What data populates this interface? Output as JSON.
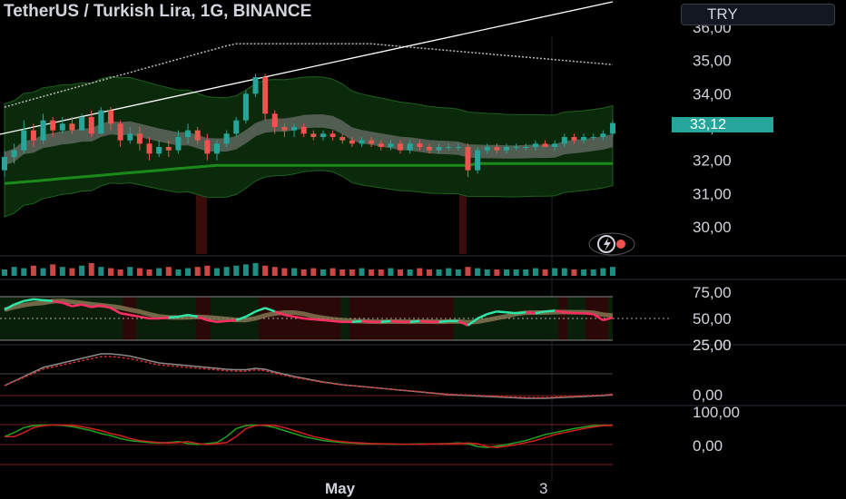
{
  "header": {
    "title": "TetherUS / Turkish Lira, 1G, BINANCE",
    "currency_button": "TRY"
  },
  "price_tag": {
    "value": "33,12",
    "color": "#26a69a"
  },
  "colors": {
    "up": "#26a69a",
    "down": "#ef5350",
    "band_fill": "#0b2a0b",
    "ema_green": "#1b8a1b",
    "rsi_line_up": "#2ee6a8",
    "rsi_line_down": "#ff2e63",
    "white_line": "#ffffff"
  },
  "icons": {
    "logo": "lightning-bolt-icon"
  },
  "chart_data": [
    {
      "type": "candlestick",
      "title": "TetherUS / Turkish Lira, 1G, BINANCE",
      "y_ticks": [
        "30,00",
        "31,00",
        "32,00",
        "33,00",
        "34,00",
        "35,00",
        "36,00"
      ],
      "ylim": [
        29.3,
        36.3
      ],
      "x_ticks": [
        "May",
        "3"
      ],
      "last_price": 33.12,
      "candles": [
        [
          31.7,
          32.3,
          31.5,
          32.1
        ],
        [
          32.1,
          32.5,
          31.9,
          32.3
        ],
        [
          32.3,
          33.2,
          32.2,
          32.9
        ],
        [
          32.9,
          33.1,
          32.4,
          32.6
        ],
        [
          32.6,
          33.4,
          32.5,
          33.2
        ],
        [
          33.2,
          33.3,
          32.7,
          32.9
        ],
        [
          32.9,
          33.3,
          32.8,
          33.1
        ],
        [
          33.1,
          33.3,
          32.8,
          32.9
        ],
        [
          32.9,
          33.4,
          32.9,
          33.3
        ],
        [
          33.3,
          33.5,
          32.7,
          32.8
        ],
        [
          32.8,
          33.6,
          32.8,
          33.5
        ],
        [
          33.5,
          33.6,
          32.9,
          33.1
        ],
        [
          33.1,
          33.2,
          32.4,
          32.6
        ],
        [
          32.6,
          33.0,
          32.5,
          32.8
        ],
        [
          32.8,
          33.0,
          32.3,
          32.5
        ],
        [
          32.5,
          32.7,
          32.0,
          32.2
        ],
        [
          32.2,
          32.6,
          32.1,
          32.4
        ],
        [
          32.4,
          32.6,
          32.1,
          32.3
        ],
        [
          32.3,
          32.9,
          32.2,
          32.7
        ],
        [
          32.7,
          33.1,
          32.5,
          32.9
        ],
        [
          32.9,
          33.0,
          32.5,
          32.6
        ],
        [
          32.6,
          32.8,
          32.0,
          32.2
        ],
        [
          32.2,
          32.6,
          32.0,
          32.5
        ],
        [
          32.5,
          32.9,
          32.4,
          32.8
        ],
        [
          32.8,
          33.3,
          32.7,
          33.2
        ],
        [
          33.2,
          34.1,
          33.1,
          34.0
        ],
        [
          34.0,
          34.6,
          33.9,
          34.5
        ],
        [
          34.5,
          34.6,
          33.2,
          33.4
        ],
        [
          33.4,
          33.5,
          32.8,
          33.0
        ],
        [
          33.0,
          33.1,
          32.7,
          32.9
        ],
        [
          32.9,
          33.1,
          32.7,
          33.0
        ],
        [
          33.0,
          33.1,
          32.7,
          32.8
        ],
        [
          32.8,
          32.9,
          32.6,
          32.7
        ],
        [
          32.7,
          32.9,
          32.6,
          32.8
        ],
        [
          32.8,
          32.9,
          32.6,
          32.7
        ],
        [
          32.7,
          32.8,
          32.5,
          32.6
        ],
        [
          32.6,
          32.7,
          32.4,
          32.5
        ],
        [
          32.5,
          32.7,
          32.4,
          32.6
        ],
        [
          32.6,
          32.7,
          32.4,
          32.5
        ],
        [
          32.5,
          32.6,
          32.3,
          32.4
        ],
        [
          32.4,
          32.6,
          32.3,
          32.5
        ],
        [
          32.5,
          32.6,
          32.2,
          32.3
        ],
        [
          32.3,
          32.6,
          32.2,
          32.5
        ],
        [
          32.5,
          32.6,
          32.3,
          32.4
        ],
        [
          32.4,
          32.5,
          32.2,
          32.3
        ],
        [
          32.3,
          32.5,
          32.2,
          32.4
        ],
        [
          32.4,
          32.5,
          32.3,
          32.4
        ],
        [
          32.4,
          32.5,
          32.3,
          32.4
        ],
        [
          32.4,
          32.5,
          31.5,
          31.7
        ],
        [
          31.7,
          32.4,
          31.6,
          32.3
        ],
        [
          32.3,
          32.5,
          32.2,
          32.4
        ],
        [
          32.4,
          32.5,
          32.2,
          32.3
        ],
        [
          32.3,
          32.5,
          32.2,
          32.4
        ],
        [
          32.4,
          32.5,
          32.3,
          32.4
        ],
        [
          32.4,
          32.5,
          32.3,
          32.4
        ],
        [
          32.4,
          32.6,
          32.3,
          32.5
        ],
        [
          32.5,
          32.6,
          32.4,
          32.4
        ],
        [
          32.4,
          32.6,
          32.3,
          32.5
        ],
        [
          32.5,
          32.8,
          32.4,
          32.7
        ],
        [
          32.7,
          32.8,
          32.5,
          32.6
        ],
        [
          32.6,
          32.8,
          32.5,
          32.7
        ],
        [
          32.7,
          32.8,
          32.6,
          32.7
        ],
        [
          32.7,
          32.9,
          32.6,
          32.8
        ],
        [
          32.8,
          33.2,
          32.7,
          33.12
        ]
      ]
    },
    {
      "type": "bar",
      "name": "volume",
      "values": [
        5,
        7,
        6,
        8,
        6,
        9,
        7,
        6,
        8,
        10,
        7,
        6,
        5,
        7,
        6,
        5,
        6,
        7,
        5,
        6,
        7,
        8,
        6,
        7,
        8,
        9,
        10,
        8,
        7,
        6,
        6,
        5,
        6,
        5,
        6,
        5,
        5,
        6,
        5,
        5,
        6,
        5,
        5,
        6,
        5,
        5,
        6,
        5,
        7,
        6,
        5,
        5,
        5,
        5,
        5,
        6,
        5,
        6,
        6,
        5,
        5,
        5,
        6,
        7
      ]
    },
    {
      "type": "line",
      "name": "oscillator",
      "y_ticks": [
        "25,00",
        "50,00",
        "75,00"
      ],
      "ylim": [
        20,
        80
      ],
      "values": [
        60,
        66,
        70,
        72,
        71,
        70,
        68,
        64,
        66,
        63,
        65,
        62,
        56,
        54,
        52,
        50,
        50,
        51,
        52,
        54,
        52,
        48,
        46,
        47,
        48,
        52,
        58,
        62,
        58,
        54,
        52,
        50,
        49,
        48,
        47,
        46,
        46,
        47,
        46,
        46,
        47,
        46,
        46,
        47,
        46,
        46,
        47,
        47,
        42,
        50,
        55,
        58,
        57,
        56,
        57,
        56,
        58,
        59,
        57,
        56,
        56,
        55,
        48,
        51
      ]
    },
    {
      "type": "line",
      "name": "macd",
      "y_ticks": [
        "0,00",
        "25,00"
      ],
      "values": [
        0.3,
        0.4,
        0.5,
        0.6,
        0.7,
        0.75,
        0.8,
        0.85,
        0.9,
        0.95,
        1.0,
        1.0,
        0.98,
        0.95,
        0.9,
        0.85,
        0.8,
        0.78,
        0.76,
        0.74,
        0.72,
        0.7,
        0.68,
        0.66,
        0.65,
        0.65,
        0.68,
        0.66,
        0.6,
        0.55,
        0.5,
        0.46,
        0.42,
        0.38,
        0.35,
        0.32,
        0.3,
        0.28,
        0.26,
        0.24,
        0.22,
        0.2,
        0.18,
        0.16,
        0.14,
        0.12,
        0.1,
        0.09,
        0.08,
        0.07,
        0.06,
        0.05,
        0.04,
        0.03,
        0.02,
        0.02,
        0.02,
        0.03,
        0.04,
        0.05,
        0.06,
        0.07,
        0.08,
        0.1
      ]
    },
    {
      "type": "line",
      "name": "stochastic",
      "y_ticks": [
        "0,00",
        "100,00"
      ],
      "ylim": [
        -20,
        110
      ],
      "values": [
        40,
        60,
        85,
        95,
        98,
        98,
        96,
        90,
        80,
        70,
        55,
        45,
        30,
        20,
        15,
        10,
        8,
        10,
        15,
        5,
        0,
        5,
        10,
        40,
        80,
        95,
        98,
        95,
        85,
        70,
        55,
        40,
        30,
        20,
        15,
        10,
        8,
        5,
        4,
        3,
        2,
        2,
        2,
        3,
        3,
        4,
        5,
        8,
        4,
        -10,
        -15,
        -8,
        0,
        10,
        20,
        35,
        50,
        60,
        70,
        80,
        88,
        94,
        96,
        97
      ]
    }
  ]
}
